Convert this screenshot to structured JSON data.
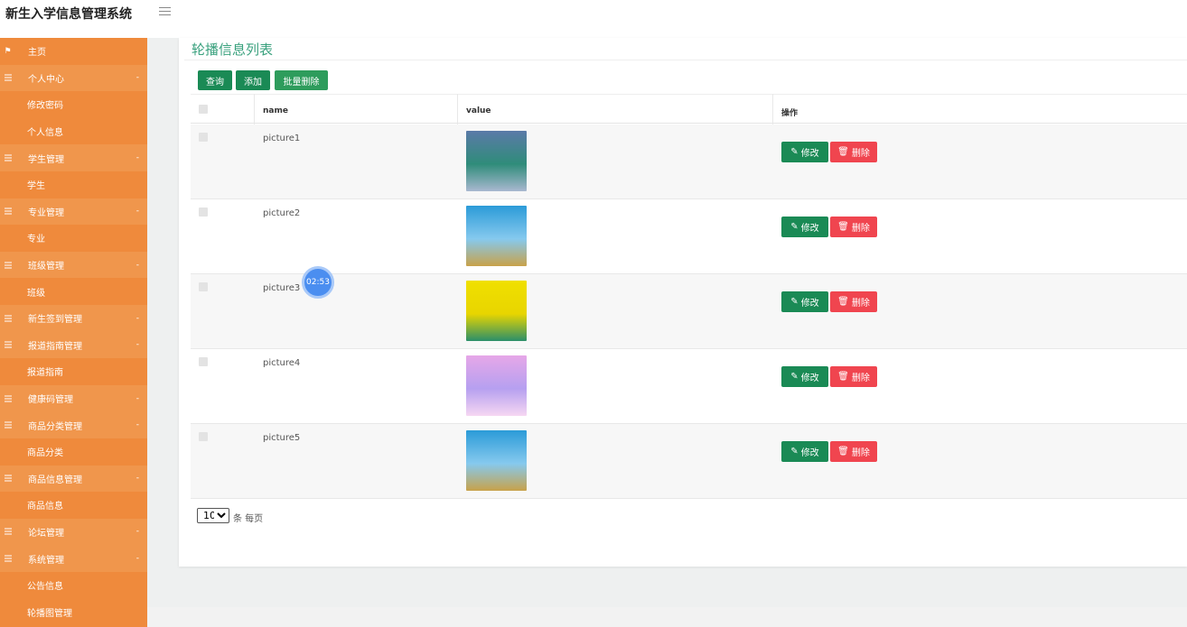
{
  "header": {
    "title": "新生入学信息管理系统"
  },
  "sidebar": {
    "items": [
      {
        "type": "home",
        "label": "主页",
        "icon": "flag-icon"
      },
      {
        "type": "group",
        "label": "个人中心",
        "icon": "list-icon",
        "arrow": "-"
      },
      {
        "type": "sub",
        "label": "修改密码"
      },
      {
        "type": "sub",
        "label": "个人信息"
      },
      {
        "type": "group",
        "label": "学生管理",
        "icon": "list-icon",
        "arrow": "-"
      },
      {
        "type": "sub",
        "label": "学生"
      },
      {
        "type": "group",
        "label": "专业管理",
        "icon": "list-icon",
        "arrow": "-"
      },
      {
        "type": "sub",
        "label": "专业"
      },
      {
        "type": "group",
        "label": "班级管理",
        "icon": "list-icon",
        "arrow": "-"
      },
      {
        "type": "sub",
        "label": "班级"
      },
      {
        "type": "group",
        "label": "新生签到管理",
        "icon": "list-icon",
        "arrow": "-"
      },
      {
        "type": "group",
        "label": "报道指南管理",
        "icon": "list-icon",
        "arrow": "-"
      },
      {
        "type": "sub",
        "label": "报道指南"
      },
      {
        "type": "group",
        "label": "健康码管理",
        "icon": "list-icon",
        "arrow": "-"
      },
      {
        "type": "group",
        "label": "商品分类管理",
        "icon": "list-icon",
        "arrow": "-"
      },
      {
        "type": "sub",
        "label": "商品分类"
      },
      {
        "type": "group",
        "label": "商品信息管理",
        "icon": "list-icon",
        "arrow": "-"
      },
      {
        "type": "sub",
        "label": "商品信息"
      },
      {
        "type": "group",
        "label": "论坛管理",
        "icon": "list-icon",
        "arrow": "-"
      },
      {
        "type": "group",
        "label": "系统管理",
        "icon": "list-icon",
        "arrow": "-"
      },
      {
        "type": "sub",
        "label": "公告信息"
      },
      {
        "type": "sub",
        "label": "轮播图管理"
      }
    ]
  },
  "main": {
    "title": "轮播信息列表",
    "toolbar": {
      "query": "查询",
      "add": "添加",
      "batch_delete": "批量删除"
    },
    "table": {
      "columns": [
        "name",
        "value",
        "操作"
      ],
      "rows": [
        {
          "name": "picture1",
          "thumb_colors": [
            "#5b7aa8",
            "#2f8c7a",
            "#a9b8d0"
          ]
        },
        {
          "name": "picture2",
          "thumb_colors": [
            "#2b9bd8",
            "#86c9ee",
            "#c8a24a"
          ]
        },
        {
          "name": "picture3",
          "thumb_colors": [
            "#f0e000",
            "#e8d500",
            "#2b8f6a"
          ]
        },
        {
          "name": "picture4",
          "thumb_colors": [
            "#e6a7e8",
            "#b6a0f0",
            "#f6d7f2"
          ]
        },
        {
          "name": "picture5",
          "thumb_colors": [
            "#2b9bd8",
            "#86c9ee",
            "#c8a24a"
          ]
        }
      ],
      "edit_label": "修改",
      "delete_label": "删除"
    },
    "pagination": {
      "page_size": "10",
      "page_size_label": "条 每页"
    }
  },
  "timer": {
    "value": "02:53"
  },
  "colors": {
    "sidebar": "#ef8a3c",
    "accent": "#3aa17e",
    "primary_button": "#1a8a55",
    "danger_button": "#f0454f"
  }
}
